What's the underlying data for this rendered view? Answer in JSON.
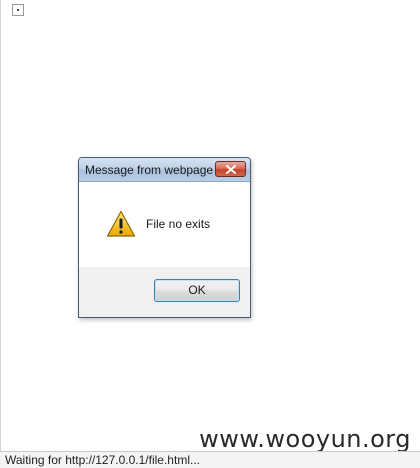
{
  "page": {
    "broken_image_icon": "broken-image-icon"
  },
  "dialog": {
    "title": "Message from webpage",
    "close_icon": "close-icon",
    "warning_icon": "warning-icon",
    "message": "File no exits",
    "ok_label": "OK"
  },
  "watermark": {
    "text": "www.wooyun.org"
  },
  "statusbar": {
    "text": "Waiting for http://127.0.0.1/file.html..."
  },
  "colors": {
    "close_button": "#c4432c",
    "ok_focus_border": "#3c7fb1",
    "warning_yellow": "#f5c518"
  }
}
